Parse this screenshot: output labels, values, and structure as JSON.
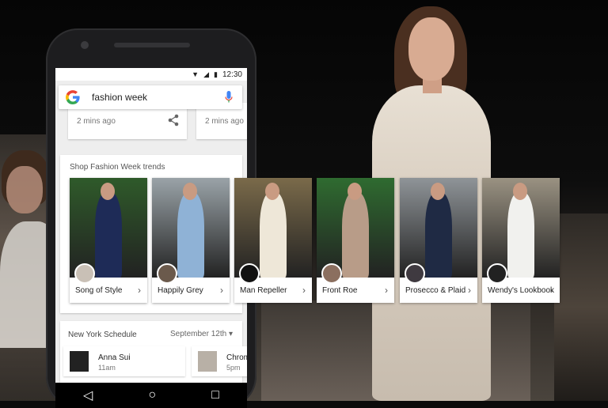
{
  "status_bar": {
    "time": "12:30",
    "wifi_icon": "wifi-icon",
    "signal_icon": "signal-icon",
    "battery_icon": "battery-icon"
  },
  "search": {
    "query": "fashion week",
    "logo": "google-logo",
    "mic_icon": "mic-icon"
  },
  "news": {
    "cards": [
      {
        "time": "2 mins ago",
        "icon": "share-icon"
      },
      {
        "time": "2 mins ago"
      }
    ]
  },
  "trends": {
    "title": "Shop Fashion Week trends",
    "items": [
      {
        "label": "Song of Style",
        "colors": {
          "bg": "#2f5a2a",
          "fig": "#1e2b57",
          "avatar": "#c9c0b6"
        }
      },
      {
        "label": "Happily Grey",
        "colors": {
          "bg": "#9aa3a8",
          "fig": "#8fb2d6",
          "avatar": "#6b5a4c"
        }
      },
      {
        "label": "Man Repeller",
        "colors": {
          "bg": "#7a6a4a",
          "fig": "#eee7d8",
          "avatar": "#111111"
        }
      },
      {
        "label": "Front Roe",
        "colors": {
          "bg": "#2f6b30",
          "fig": "#b89c88",
          "avatar": "#8b6f5f"
        }
      },
      {
        "label": "Prosecco & Plaid",
        "colors": {
          "bg": "#8f9498",
          "fig": "#1f2a44",
          "avatar": "#3f3a40"
        }
      },
      {
        "label": "Wendy's Lookbook",
        "colors": {
          "bg": "#9a9282",
          "fig": "#f1f1ee",
          "avatar": "#222222"
        }
      }
    ]
  },
  "schedule": {
    "title": "New York Schedule",
    "date": "September 12th",
    "items": [
      {
        "name": "Anna Sui",
        "time": "11am"
      },
      {
        "name": "Chrom",
        "time": "5pm"
      }
    ]
  },
  "nav": {
    "back": "◁",
    "home": "○",
    "recents": "□"
  }
}
